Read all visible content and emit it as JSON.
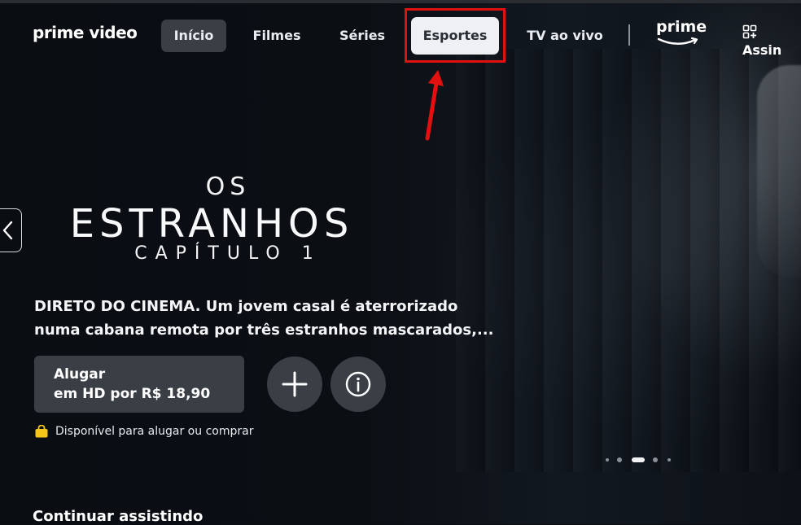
{
  "brand": {
    "name": "prime video"
  },
  "nav": {
    "items": [
      {
        "label": "Início",
        "state": "active"
      },
      {
        "label": "Filmes",
        "state": "normal"
      },
      {
        "label": "Séries",
        "state": "normal"
      },
      {
        "label": "Esportes",
        "state": "highlighted"
      },
      {
        "label": "TV ao vivo",
        "state": "normal"
      }
    ],
    "prime_logo_text": "prime",
    "subscriptions_label": "Assin"
  },
  "hero": {
    "title_top": "OS",
    "title_main": "ESTRANHOS",
    "title_sub": "CAPÍTULO 1",
    "description_line1": "DIRETO DO CINEMA. Um jovem casal é aterrorizado",
    "description_line2": "numa cabana remota por três estranhos mascarados,...",
    "rent_button_line1": "Alugar",
    "rent_button_line2": "em HD por R$ 18,90",
    "availability": "Disponível para alugar ou comprar",
    "carousel": {
      "count": 5,
      "active_index": 2
    }
  },
  "sections": {
    "continue_watching": "Continuar assistindo"
  },
  "colors": {
    "background": "#0b0f14",
    "button_bg": "#3a3f46",
    "highlight_frame": "#e31010",
    "annotation_arrow": "#e31010",
    "bag_icon": "#f5c518"
  }
}
